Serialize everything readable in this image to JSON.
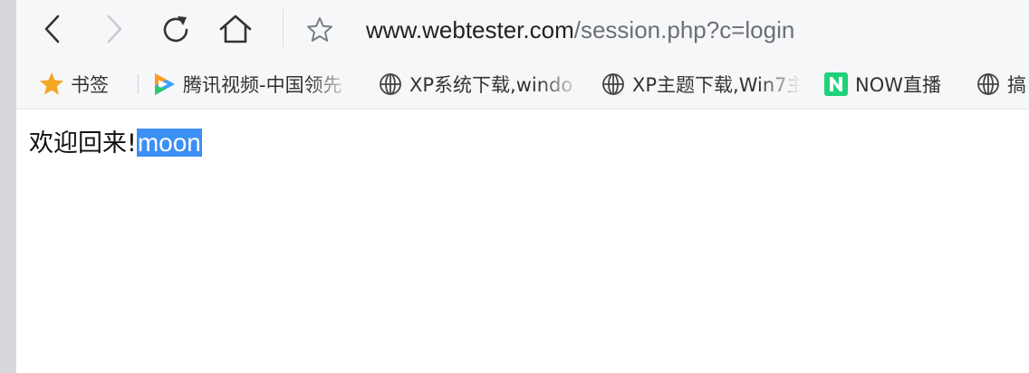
{
  "toolbar": {
    "back_icon": "chevron-left-icon",
    "forward_icon": "chevron-right-icon",
    "reload_icon": "reload-icon",
    "home_icon": "home-icon",
    "bookmark_star_icon": "star-outline-icon",
    "url_host": "www.webtester.com",
    "url_path": "/session.php?c=login"
  },
  "bookmarks": {
    "items": [
      {
        "label": "书签",
        "icon": "star-filled-icon"
      },
      {
        "label": "腾讯视频-中国领先",
        "icon": "tencent-video-icon"
      },
      {
        "label": "XP系统下载,windo",
        "icon": "globe-icon"
      },
      {
        "label": "XP主题下载,Win7主",
        "icon": "globe-icon"
      },
      {
        "label": "NOW直播",
        "icon": "now-live-icon"
      },
      {
        "label": "搞",
        "icon": "globe-icon"
      }
    ]
  },
  "page": {
    "greeting_text": "欢迎回来!",
    "username": "moon"
  },
  "colors": {
    "selection": "#3b8ff5",
    "star": "#f5a623",
    "now_green": "#1fd17a",
    "tencent_blue": "#3aa0ff",
    "tencent_orange": "#ff9a1f"
  }
}
